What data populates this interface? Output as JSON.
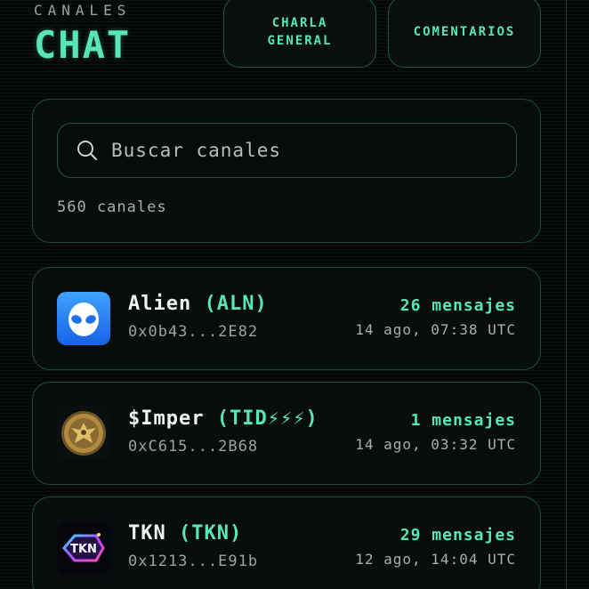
{
  "header": {
    "label": "CANALES",
    "title": "CHAT"
  },
  "tabs": [
    {
      "label_line1": "CHARLA",
      "label_line2": "GENERAL"
    },
    {
      "label": "COMENTARIOS"
    }
  ],
  "search": {
    "placeholder": "Buscar canales",
    "count_text": "560 canales"
  },
  "channels": [
    {
      "name": "Alien",
      "symbol": "(ALN)",
      "address": "0x0b43...2E82",
      "messages": "26 mensajes",
      "time": "14 ago, 07:38 UTC",
      "avatar_icon": "alien-icon"
    },
    {
      "name": "$Imper",
      "symbol": "(TID⚡⚡⚡)",
      "address": "0xC615...2B68",
      "messages": "1 mensajes",
      "time": "14 ago, 03:32 UTC",
      "avatar_icon": "eagle-coin-icon"
    },
    {
      "name": "TKN",
      "symbol": "(TKN)",
      "address": "0x1213...E91b",
      "messages": "29 mensajes",
      "time": "12 ago, 14:04 UTC",
      "avatar_icon": "tkn-logo-icon"
    }
  ],
  "colors": {
    "accent": "#56e6b8",
    "background": "#050807",
    "border": "#46aa8c"
  }
}
